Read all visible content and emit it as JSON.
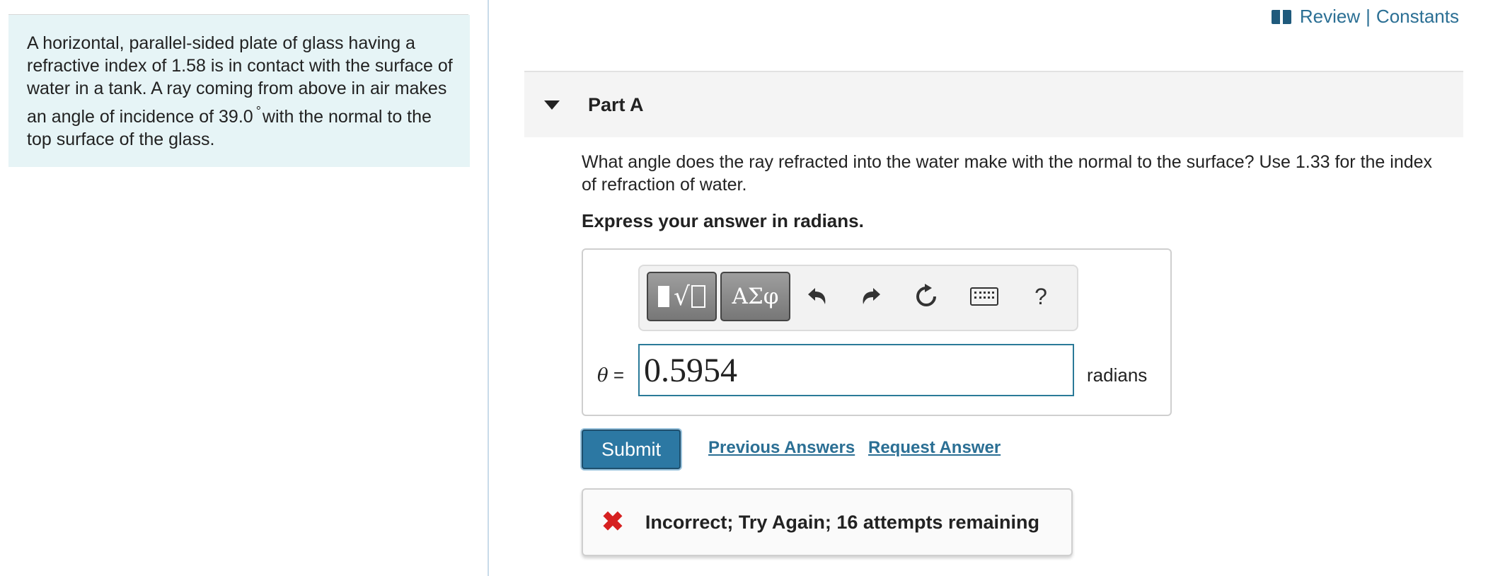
{
  "problem": {
    "text_before_degree": "A horizontal, parallel-sided plate of glass having a refractive index of 1.58 is in contact with the surface of water in a tank. A ray coming from above in air makes an angle of incidence of 39.0",
    "degree_symbol": "°",
    "text_after_degree": "with the normal to the top surface of the glass."
  },
  "top_links": {
    "icon": "book-icon",
    "review": "Review",
    "separator": "|",
    "constants": "Constants"
  },
  "part": {
    "title": "Part A",
    "question": "What angle does the ray refracted into the water make with the normal to the surface? Use 1.33 for the index of refraction of water.",
    "instruction": "Express your answer in radians."
  },
  "toolbar": {
    "greek_label": "ΑΣφ",
    "help_label": "?",
    "icons": [
      "templates-icon",
      "greek-letters-icon",
      "undo-icon",
      "redo-icon",
      "reset-icon",
      "keyboard-icon",
      "help-icon"
    ]
  },
  "answer": {
    "variable": "θ",
    "equals": "=",
    "value": "0.5954",
    "units": "radians"
  },
  "actions": {
    "submit": "Submit",
    "previous_answers": "Previous Answers",
    "request_answer": "Request Answer"
  },
  "feedback": {
    "icon": "x-icon",
    "message": "Incorrect; Try Again; 16 attempts remaining",
    "icon_color": "#d62020"
  },
  "colors": {
    "problem_bg": "#e6f4f6",
    "link": "#2b6f94",
    "submit_bg": "#2c78a3",
    "input_border": "#2b7a98"
  }
}
